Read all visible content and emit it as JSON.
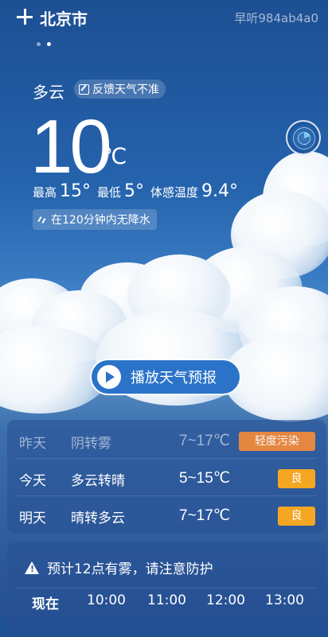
{
  "header": {
    "city": "北京市",
    "watermark": "早听984ab4a0",
    "page_dots": 2,
    "active_dot": 1
  },
  "current": {
    "condition": "多云",
    "feedback_label": "反馈天气不准",
    "temperature": "10",
    "unit": "℃",
    "high_label": "最高",
    "high_value": "15°",
    "low_label": "最低",
    "low_value": "5°",
    "feels_label": "体感温度",
    "feels_value": "9.4°",
    "rain_notice": "在120分钟内无降水"
  },
  "play_button": {
    "label": "播放天气预报"
  },
  "forecast": [
    {
      "day": "昨天",
      "condition": "阴转雾",
      "range": "7~17℃",
      "aqi": "轻度污染",
      "aqi_color": "#f08a3c"
    },
    {
      "day": "今天",
      "condition": "多云转晴",
      "range": "5~15℃",
      "aqi": "良",
      "aqi_color": "#f5a623"
    },
    {
      "day": "明天",
      "condition": "晴转多云",
      "range": "7~17℃",
      "aqi": "良",
      "aqi_color": "#f5a623"
    }
  ],
  "hourly": {
    "alert": "预计12点有雾，请注意防护",
    "hours": [
      "现在",
      "10:00",
      "11:00",
      "12:00",
      "13:00"
    ]
  },
  "colors": {
    "background_top": "#1d4f93",
    "play_button": "#2b73c9"
  },
  "icons": {
    "add": "add-icon",
    "edit": "edit-icon",
    "radar": "radar-icon",
    "rain": "rain-icon",
    "play": "play-icon",
    "warning": "warning-icon"
  }
}
